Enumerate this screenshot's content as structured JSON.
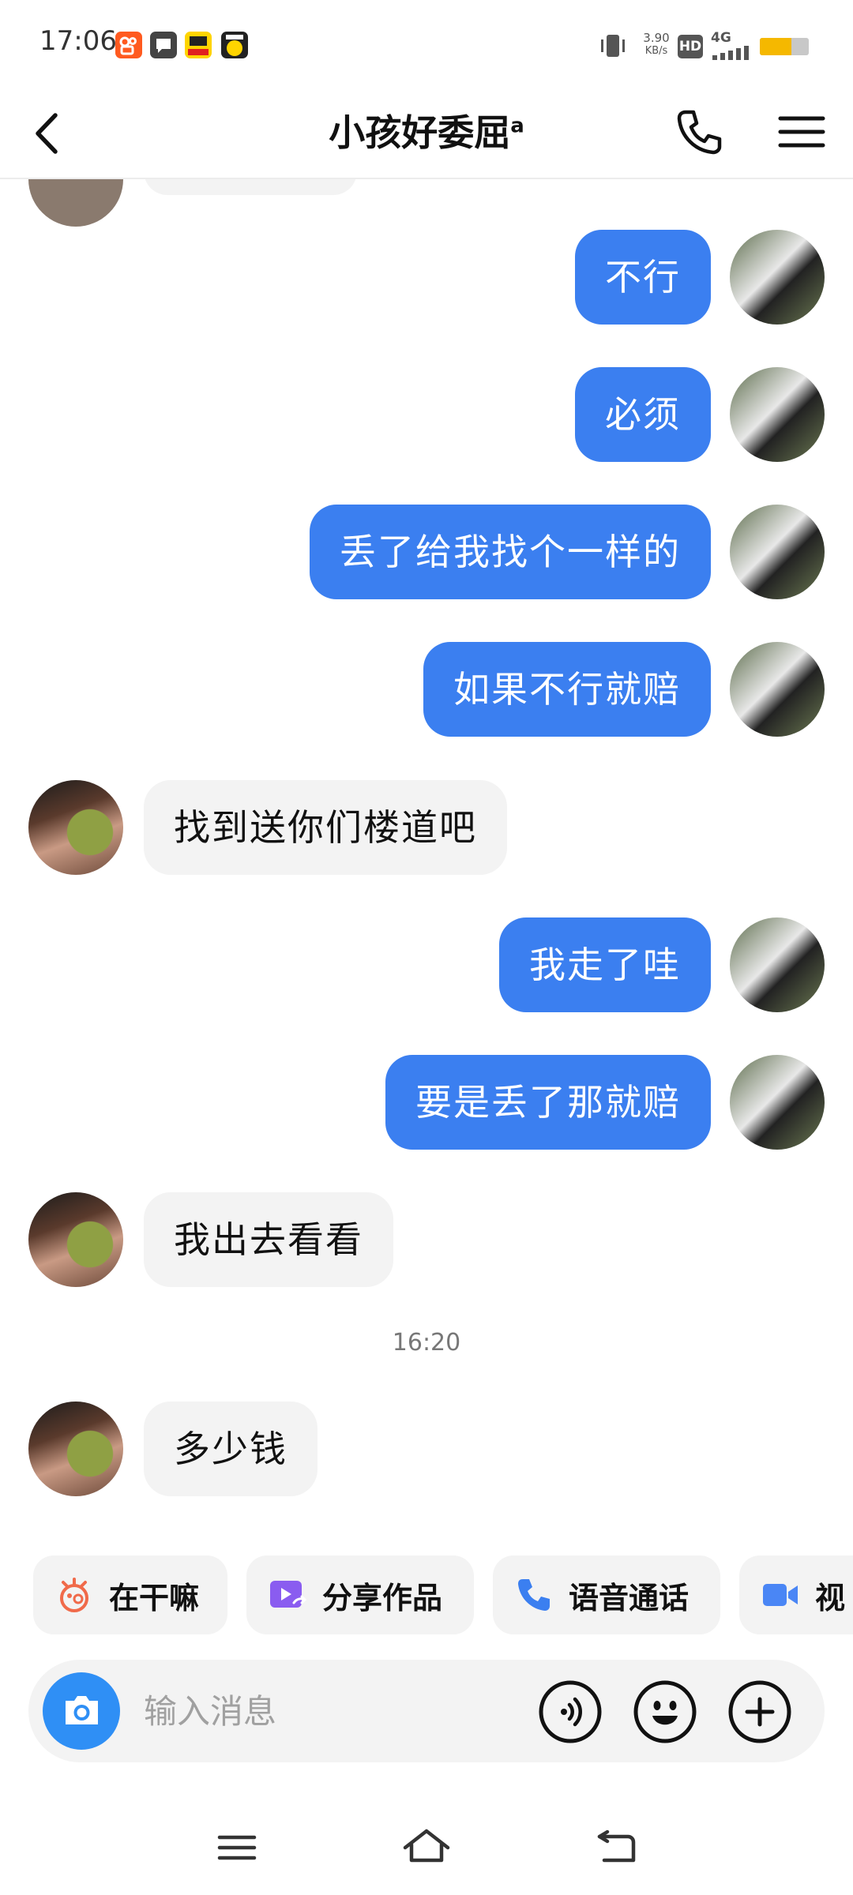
{
  "status_bar": {
    "time": "17:06",
    "net_speed_value": "3.90",
    "net_speed_unit": "KB/s",
    "hd_badge": "HD",
    "network": "4G",
    "battery_level": 0.65,
    "app_icons": [
      "kuaishou-icon",
      "chat-bubble-icon",
      "kuaishou-news-icon",
      "yellow-face-icon"
    ],
    "colors": {
      "battery": "#f5b800",
      "kuaishou": "#ff5a1f"
    }
  },
  "header": {
    "title": "小孩好委屈",
    "title_sup": "a",
    "back_icon": "chevron-left-icon",
    "call_icon": "phone-icon",
    "menu_icon": "hamburger-menu-icon"
  },
  "messages": [
    {
      "from": "me",
      "text": "不行"
    },
    {
      "from": "me",
      "text": "必须"
    },
    {
      "from": "me",
      "text": "丢了给我找个一样的"
    },
    {
      "from": "me",
      "text": "如果不行就赔"
    },
    {
      "from": "other",
      "text": "找到送你们楼道吧"
    },
    {
      "from": "me",
      "text": "我走了哇"
    },
    {
      "from": "me",
      "text": "要是丢了那就赔"
    },
    {
      "from": "other",
      "text": "我出去看看"
    },
    {
      "time": "16:20"
    },
    {
      "from": "other",
      "text": "多少钱"
    }
  ],
  "quick_actions": [
    {
      "label": "在干嘛",
      "icon": "emoji-sticker-icon",
      "color": "#f06a4a"
    },
    {
      "label": "分享作品",
      "icon": "share-video-icon",
      "color": "#8a5cf0"
    },
    {
      "label": "语音通话",
      "icon": "phone-icon",
      "color": "#3b7ff0"
    },
    {
      "label": "视频通话",
      "visible_label": "视",
      "icon": "video-camera-icon",
      "color": "#4a86f5"
    }
  ],
  "input": {
    "placeholder": "输入消息",
    "value": "",
    "camera_icon": "camera-icon",
    "voice_icon": "voice-wave-icon",
    "emoji_icon": "smiley-icon",
    "plus_icon": "plus-icon",
    "colors": {
      "camera_bg": "#2f8ff5"
    }
  },
  "nav_bar": {
    "icons": [
      "nav-menu-icon",
      "nav-home-icon",
      "nav-back-icon"
    ]
  },
  "colors": {
    "my_bubble": "#3b7ff0",
    "other_bubble": "#f3f3f3",
    "background": "#ffffff"
  }
}
